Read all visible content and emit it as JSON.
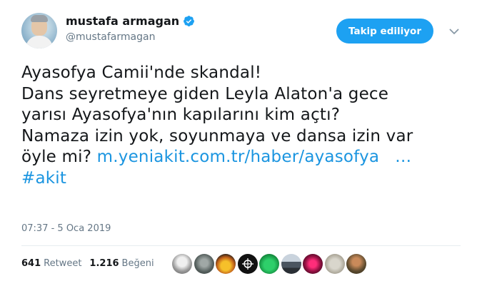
{
  "author": {
    "display_name": "mustafa armagan",
    "handle": "@mustafarmagan",
    "verified": true
  },
  "follow_button_label": "Takip ediliyor",
  "tweet": {
    "lines": [
      "Ayasofya Camii'nde skandal!",
      "Dans seyretmeye giden Leyla Alaton'a gece",
      "yarısı Ayasofya'nın kapılarını kim açtı?",
      "Namaza izin yok, soyunmaya ve dansa izin var"
    ],
    "line5_prefix": "öyle mi? ",
    "link_text": "m.yeniakit.com.tr/haber/ayasofya",
    "link_ellipsis": "…",
    "hashtag": "#akit"
  },
  "timestamp": "07:37 - 5 Oca 2019",
  "stats": {
    "retweets": "641",
    "retweets_label": "Retweet",
    "likes": "1.216",
    "likes_label": "Beğeni"
  },
  "colors": {
    "accent": "#1da1f2",
    "link": "#1b95e0",
    "secondary_text": "#657786"
  }
}
